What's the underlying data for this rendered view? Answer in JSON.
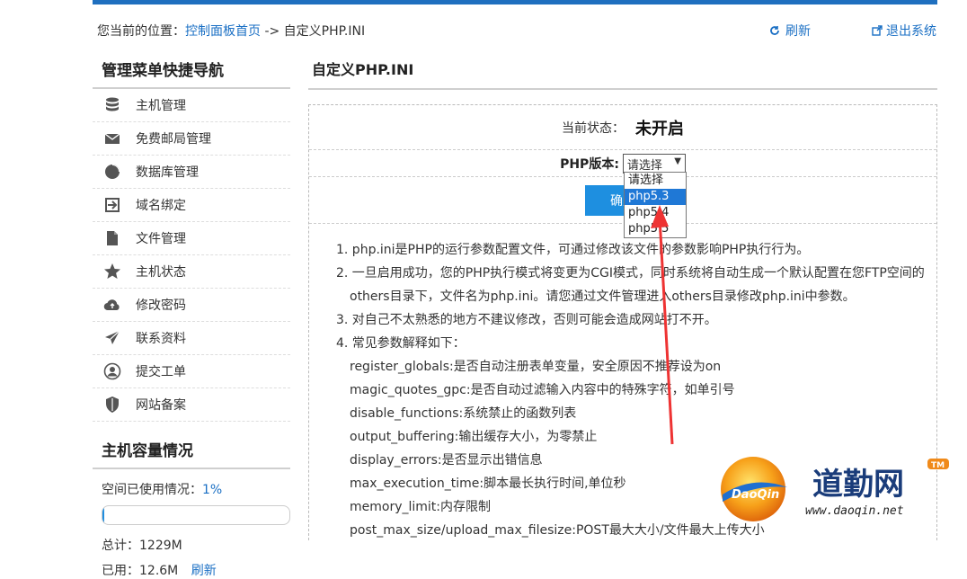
{
  "header": {
    "crumb_prefix": "您当前的位置：",
    "crumb_link": "控制面板首页",
    "crumb_suffix": " -> 自定义PHP.INI",
    "refresh": "刷新",
    "logout": "退出系统"
  },
  "sidebar": {
    "title": "管理菜单快捷导航",
    "items": [
      {
        "label": "主机管理",
        "icon": "database-icon"
      },
      {
        "label": "免费邮局管理",
        "icon": "mail-icon"
      },
      {
        "label": "数据库管理",
        "icon": "pie-icon"
      },
      {
        "label": "域名绑定",
        "icon": "login-icon"
      },
      {
        "label": "文件管理",
        "icon": "file-icon"
      },
      {
        "label": "主机状态",
        "icon": "star-icon"
      },
      {
        "label": "修改密码",
        "icon": "cloud-icon"
      },
      {
        "label": "联系资料",
        "icon": "send-icon"
      },
      {
        "label": "提交工单",
        "icon": "user-icon"
      },
      {
        "label": "网站备案",
        "icon": "shield-icon"
      }
    ],
    "capacity_title": "主机容量情况",
    "used_label": "空间已使用情况：",
    "used_pct": "1%",
    "used_fraction": 0.01,
    "total": "总计：1229M",
    "used_partial": "已用：12.6M",
    "refresh_partial": "刷新"
  },
  "main": {
    "title": "自定义PHP.INI",
    "status_label": "当前状态：",
    "status_value": "未开启",
    "php_label": "PHP版本:",
    "select_value": "请选择",
    "options": [
      "请选择",
      "php5.3",
      "php5.4",
      "php5.5"
    ],
    "confirm": "确定",
    "notes": [
      "1. php.ini是PHP的运行参数配置文件，可通过修改该文件的参数影响PHP执行行为。",
      "2. 一旦启用成功，您的PHP执行模式将变更为CGI模式，同时系统将自动生成一个默认配置在您FTP空间的",
      "others目录下，文件名为php.ini。请您通过文件管理进入others目录修改php.ini中参数。",
      "3. 对自己不太熟悉的地方不建议修改，否则可能会造成网站打不开。",
      "4. 常见参数解释如下：",
      "register_globals:是否自动注册表单变量，安全原因不推荐设为on",
      "magic_quotes_gpc:是否自动过滤输入内容中的特殊字符，如单引号",
      "disable_functions:系统禁止的函数列表",
      "output_buffering:输出缓存大小，为零禁止",
      "display_errors:是否显示出错信息",
      "max_execution_time:脚本最长执行时间,单位秒",
      "memory_limit:内存限制",
      "post_max_size/upload_max_filesize:POST最大大小/文件最大上传大小"
    ]
  },
  "watermark": {
    "logo_text": "DaoQin",
    "brand": "道勤网",
    "tm": "TM",
    "url": "www.daoqin.net"
  }
}
